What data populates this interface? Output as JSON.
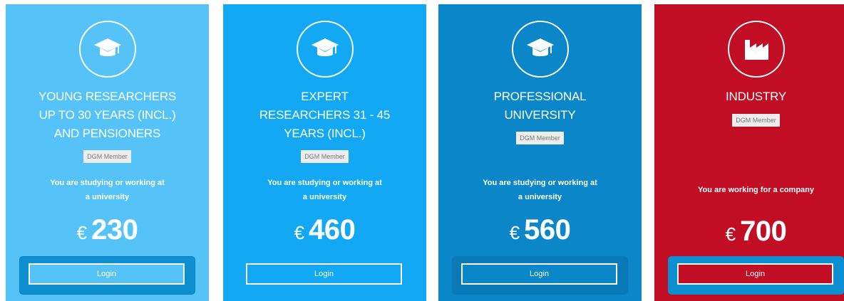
{
  "pricing": {
    "currency": "€",
    "plans": [
      {
        "icon": "graduation-cap-icon",
        "color": "#55c3f8",
        "title": "YOUNG RESEARCHERS\nUP TO 30 YEARS (INCL.)\nAND PENSIONERS",
        "badge": "DGM Member",
        "description": "You are studying or working at\na university",
        "price": "230",
        "button_label": "Login"
      },
      {
        "icon": "graduation-cap-icon",
        "color": "#12a8f3",
        "title": "EXPERT\nRESEARCHERS 31 - 45\nYEARS (INCL.)",
        "badge": "DGM Member",
        "description": "You are studying or working at\na university",
        "price": "460",
        "button_label": "Login"
      },
      {
        "icon": "graduation-cap-icon",
        "color": "#0b87c9",
        "title": "PROFESSIONAL\nUNIVERSITY",
        "badge": "DGM Member",
        "description": "You are studying or working at\na university",
        "price": "560",
        "button_label": "Login"
      },
      {
        "icon": "factory-icon",
        "color": "#c10e25",
        "title": "INDUSTRY",
        "badge": "DGM Member",
        "description": "You are working for a company",
        "price": "700",
        "button_label": "Login"
      }
    ]
  }
}
